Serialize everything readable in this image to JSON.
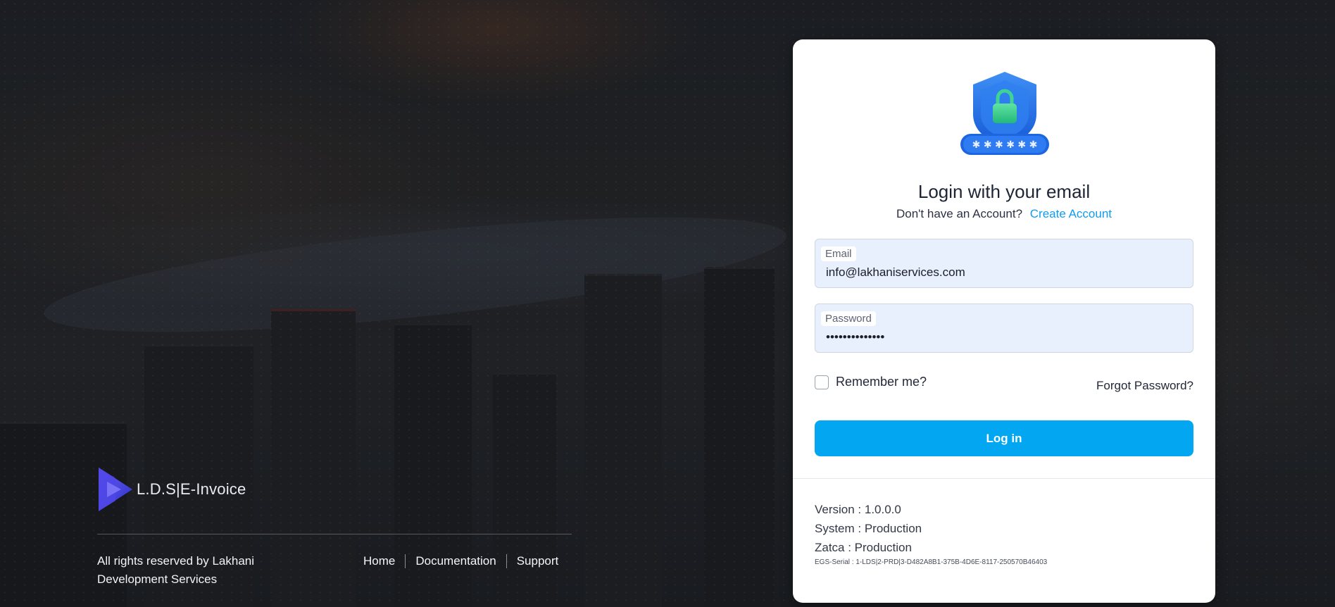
{
  "brand": {
    "name": "L.D.S|E-Invoice",
    "logo_icon": "play-triangle-logo"
  },
  "footer": {
    "copyright": "All rights reserved by Lakhani Development Services",
    "links": [
      "Home",
      "Documentation",
      "Support"
    ]
  },
  "login": {
    "illustration_icon": "shield-lock-password-icon",
    "title": "Login with your email",
    "no_account_text": "Don't have an Account?",
    "create_account_link": "Create Account",
    "email": {
      "label": "Email",
      "value": "info@lakhaniservices.com"
    },
    "password": {
      "label": "Password",
      "value": "••••••••••••••"
    },
    "remember_label": "Remember me?",
    "remember_checked": false,
    "forgot_link": "Forgot Password?",
    "submit_label": "Log in"
  },
  "system_info": {
    "version": "Version : 1.0.0.0",
    "system": "System : Production",
    "zatca": "Zatca : Production",
    "egs_serial": "EGS-Serial : 1-LDS|2-PRD|3-D482A8B1-375B-4D6E-8117-250570B46403"
  },
  "colors": {
    "primary_button": "#03a6f0",
    "link": "#109cf1",
    "input_bg": "#e8f0fe"
  }
}
